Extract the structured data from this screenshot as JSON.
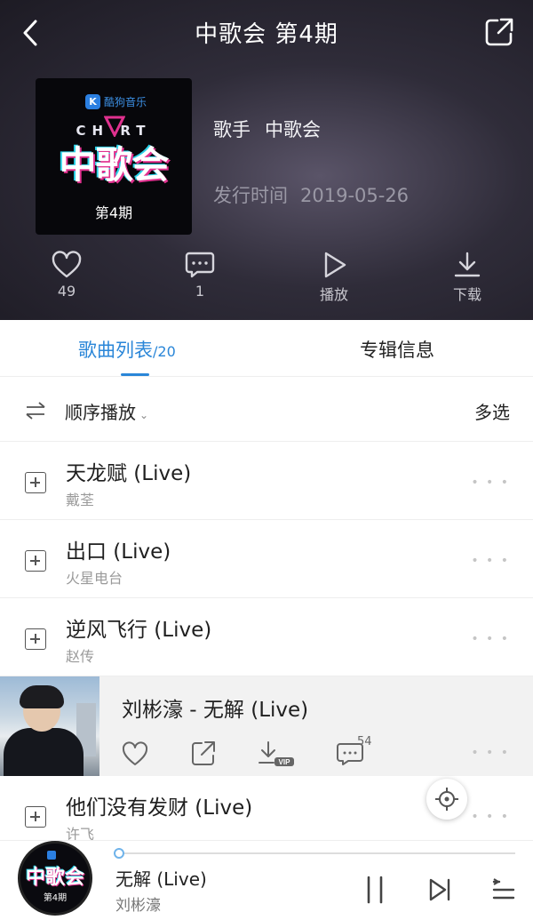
{
  "header": {
    "title": "中歌会 第4期",
    "back_icon": "chevron-left-icon",
    "share_icon": "share-icon"
  },
  "album": {
    "cover": {
      "brand": "酷狗音乐",
      "brand_letter": "K",
      "chart_word": "CH RT",
      "big_text": "中歌会",
      "episode": "第4期"
    },
    "artist_label": "歌手",
    "artist_value": "中歌会",
    "date_label": "发行时间",
    "date_value": "2019-05-26"
  },
  "actions": [
    {
      "icon": "heart-icon",
      "label": "49"
    },
    {
      "icon": "comment-icon",
      "label": "1"
    },
    {
      "icon": "play-icon",
      "label": "播放"
    },
    {
      "icon": "download-icon",
      "label": "下载"
    }
  ],
  "tabs": {
    "list_label": "歌曲列表",
    "list_count": "/20",
    "info_label": "专辑信息"
  },
  "list_controls": {
    "order_label": "顺序播放",
    "multi_label": "多选"
  },
  "songs": [
    {
      "title": "天龙赋 (Live)",
      "artist": "戴荃"
    },
    {
      "title": "出口 (Live)",
      "artist": "火星电台"
    },
    {
      "title": "逆风飞行 (Live)",
      "artist": "赵传"
    },
    {
      "title": "他们没有发财 (Live)",
      "artist": "许飞"
    }
  ],
  "expanded_song": {
    "title": "刘彬濠 - 无解 (Live)",
    "comment_count": "54",
    "vip_badge": "VIP"
  },
  "player": {
    "title": "无解 (Live)",
    "artist": "刘彬濠",
    "cover_big": "中歌会",
    "cover_episode": "第4期",
    "progress": 0.0,
    "accent": "#2a86d8"
  },
  "more_glyph": "• • •"
}
